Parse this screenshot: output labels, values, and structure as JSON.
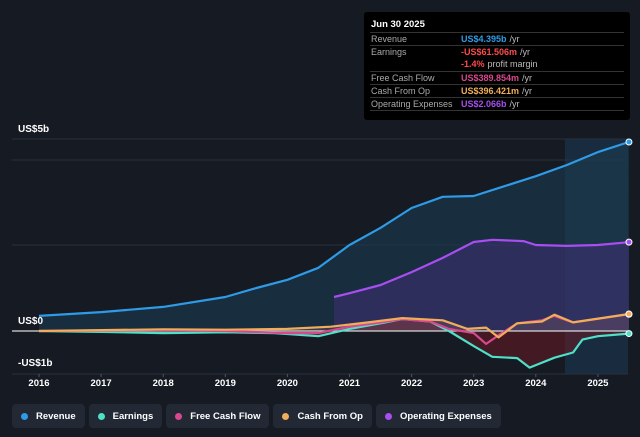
{
  "tooltip": {
    "date": "Jun 30 2025",
    "rows": [
      {
        "label": "Revenue",
        "value": "US$4.395b",
        "unit": "/yr",
        "color": "#2f9be6"
      },
      {
        "label": "Earnings",
        "value": "-US$61.506m",
        "unit": "/yr",
        "color": "#ff4b4b"
      },
      {
        "label": "",
        "value": "-1.4%",
        "unit": "profit margin",
        "color": "#ff4b4b"
      },
      {
        "label": "Free Cash Flow",
        "value": "US$389.854m",
        "unit": "/yr",
        "color": "#d9488f"
      },
      {
        "label": "Cash From Op",
        "value": "US$396.421m",
        "unit": "/yr",
        "color": "#f0ad5a"
      },
      {
        "label": "Operating Expenses",
        "value": "US$2.066b",
        "unit": "/yr",
        "color": "#a84ef0"
      }
    ]
  },
  "chart_data": {
    "type": "line",
    "ylabels": {
      "top": "US$5b",
      "zero": "US$0",
      "bottom": "-US$1b"
    },
    "ylim": [
      -1,
      4.5
    ],
    "xlim": [
      2016,
      2025.5
    ],
    "x_ticks": [
      "2016",
      "2017",
      "2018",
      "2019",
      "2020",
      "2021",
      "2022",
      "2023",
      "2024",
      "2025"
    ],
    "grid": true,
    "legend_position": "bottom",
    "series": [
      {
        "name": "Revenue",
        "color": "#2f9be6",
        "points": [
          [
            2016,
            0.35
          ],
          [
            2017,
            0.44
          ],
          [
            2018,
            0.56
          ],
          [
            2019,
            0.79
          ],
          [
            2019.5,
            1.0
          ],
          [
            2020,
            1.19
          ],
          [
            2020.5,
            1.47
          ],
          [
            2021,
            2.0
          ],
          [
            2021.5,
            2.4
          ],
          [
            2022,
            2.86
          ],
          [
            2022.5,
            3.12
          ],
          [
            2023,
            3.14
          ],
          [
            2023.5,
            3.37
          ],
          [
            2024,
            3.6
          ],
          [
            2024.5,
            3.86
          ],
          [
            2025,
            4.16
          ],
          [
            2025.5,
            4.395
          ]
        ]
      },
      {
        "name": "Earnings",
        "color": "#4fe0c8",
        "points": [
          [
            2016,
            0
          ],
          [
            2017,
            -0.02
          ],
          [
            2018,
            -0.05
          ],
          [
            2019,
            -0.03
          ],
          [
            2019.8,
            -0.05
          ],
          [
            2020.5,
            -0.12
          ],
          [
            2021,
            0.05
          ],
          [
            2021.5,
            0.18
          ],
          [
            2021.85,
            0.28
          ],
          [
            2022.3,
            0.22
          ],
          [
            2022.6,
            0.0
          ],
          [
            2023,
            -0.35
          ],
          [
            2023.3,
            -0.6
          ],
          [
            2023.7,
            -0.63
          ],
          [
            2023.9,
            -0.85
          ],
          [
            2024.3,
            -0.62
          ],
          [
            2024.6,
            -0.5
          ],
          [
            2024.75,
            -0.2
          ],
          [
            2025,
            -0.12
          ],
          [
            2025.5,
            -0.06
          ]
        ]
      },
      {
        "name": "Free Cash Flow",
        "color": "#d9488f",
        "points": [
          [
            2016,
            0
          ],
          [
            2018,
            0.02
          ],
          [
            2019,
            0.0
          ],
          [
            2020,
            -0.05
          ],
          [
            2020.5,
            -0.05
          ],
          [
            2021,
            0.1
          ],
          [
            2021.5,
            0.2
          ],
          [
            2021.85,
            0.28
          ],
          [
            2022.3,
            0.22
          ],
          [
            2022.6,
            0.05
          ],
          [
            2023,
            -0.05
          ],
          [
            2023.2,
            -0.3
          ],
          [
            2023.4,
            -0.1
          ],
          [
            2023.7,
            0.18
          ],
          [
            2024.1,
            0.25
          ],
          [
            2024.3,
            0.35
          ],
          [
            2024.6,
            0.2
          ],
          [
            2025.5,
            0.39
          ]
        ]
      },
      {
        "name": "Cash From Op",
        "color": "#f0ad5a",
        "points": [
          [
            2016,
            0
          ],
          [
            2018,
            0.04
          ],
          [
            2019,
            0.03
          ],
          [
            2020,
            0.05
          ],
          [
            2020.7,
            0.1
          ],
          [
            2021.3,
            0.2
          ],
          [
            2021.85,
            0.3
          ],
          [
            2022.5,
            0.25
          ],
          [
            2022.9,
            0.05
          ],
          [
            2023.2,
            0.08
          ],
          [
            2023.4,
            -0.15
          ],
          [
            2023.7,
            0.18
          ],
          [
            2024.1,
            0.22
          ],
          [
            2024.3,
            0.38
          ],
          [
            2024.6,
            0.2
          ],
          [
            2025.5,
            0.396
          ]
        ]
      },
      {
        "name": "Operating Expenses",
        "color": "#a84ef0",
        "points": [
          [
            2020.75,
            0.79
          ],
          [
            2021,
            0.88
          ],
          [
            2021.5,
            1.07
          ],
          [
            2022,
            1.37
          ],
          [
            2022.5,
            1.7
          ],
          [
            2023,
            2.07
          ],
          [
            2023.3,
            2.12
          ],
          [
            2023.8,
            2.09
          ],
          [
            2024,
            2.0
          ],
          [
            2024.5,
            1.98
          ],
          [
            2025,
            2.0
          ],
          [
            2025.5,
            2.066
          ]
        ]
      }
    ]
  }
}
